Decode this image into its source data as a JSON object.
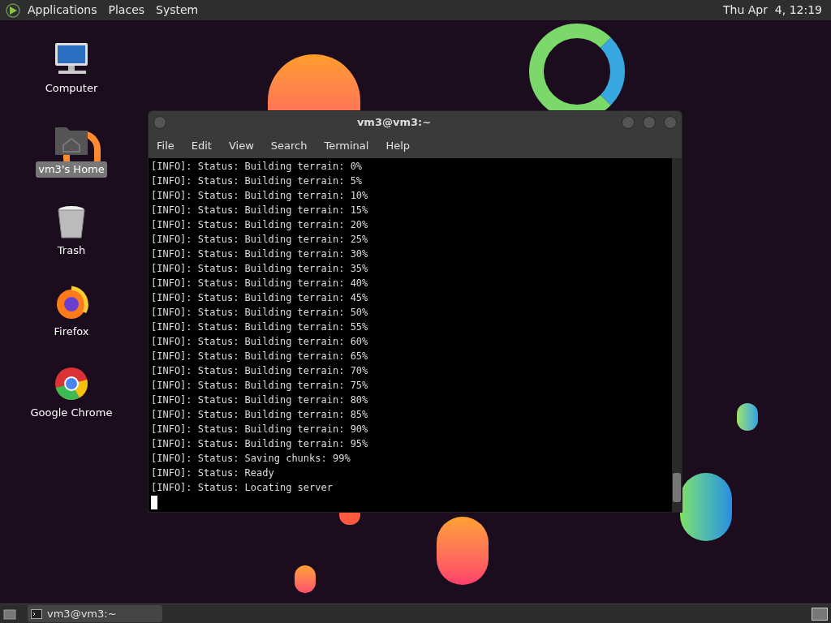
{
  "top_panel": {
    "menus": [
      "Applications",
      "Places",
      "System"
    ],
    "clock": "Thu Apr  4, 12:19"
  },
  "desktop_icons": [
    {
      "kind": "computer",
      "label": "Computer",
      "selected": false
    },
    {
      "kind": "home",
      "label": "vm3's Home",
      "selected": true
    },
    {
      "kind": "trash",
      "label": "Trash",
      "selected": false
    },
    {
      "kind": "firefox",
      "label": "Firefox",
      "selected": false
    },
    {
      "kind": "chrome",
      "label": "Google Chrome",
      "selected": false
    }
  ],
  "terminal_window": {
    "title": "vm3@vm3:~",
    "menus": [
      "File",
      "Edit",
      "View",
      "Search",
      "Terminal",
      "Help"
    ],
    "lines": [
      "[INFO]: Status: Building terrain: 0%",
      "[INFO]: Status: Building terrain: 5%",
      "[INFO]: Status: Building terrain: 10%",
      "[INFO]: Status: Building terrain: 15%",
      "[INFO]: Status: Building terrain: 20%",
      "[INFO]: Status: Building terrain: 25%",
      "[INFO]: Status: Building terrain: 30%",
      "[INFO]: Status: Building terrain: 35%",
      "[INFO]: Status: Building terrain: 40%",
      "[INFO]: Status: Building terrain: 45%",
      "[INFO]: Status: Building terrain: 50%",
      "[INFO]: Status: Building terrain: 55%",
      "[INFO]: Status: Building terrain: 60%",
      "[INFO]: Status: Building terrain: 65%",
      "[INFO]: Status: Building terrain: 70%",
      "[INFO]: Status: Building terrain: 75%",
      "[INFO]: Status: Building terrain: 80%",
      "[INFO]: Status: Building terrain: 85%",
      "[INFO]: Status: Building terrain: 90%",
      "[INFO]: Status: Building terrain: 95%",
      "[INFO]: Status: Saving chunks: 99%",
      "[INFO]: Status: Ready",
      "[INFO]: Status: Locating server"
    ]
  },
  "taskbar": {
    "items": [
      {
        "label": "vm3@vm3:~",
        "selected": false
      }
    ]
  }
}
